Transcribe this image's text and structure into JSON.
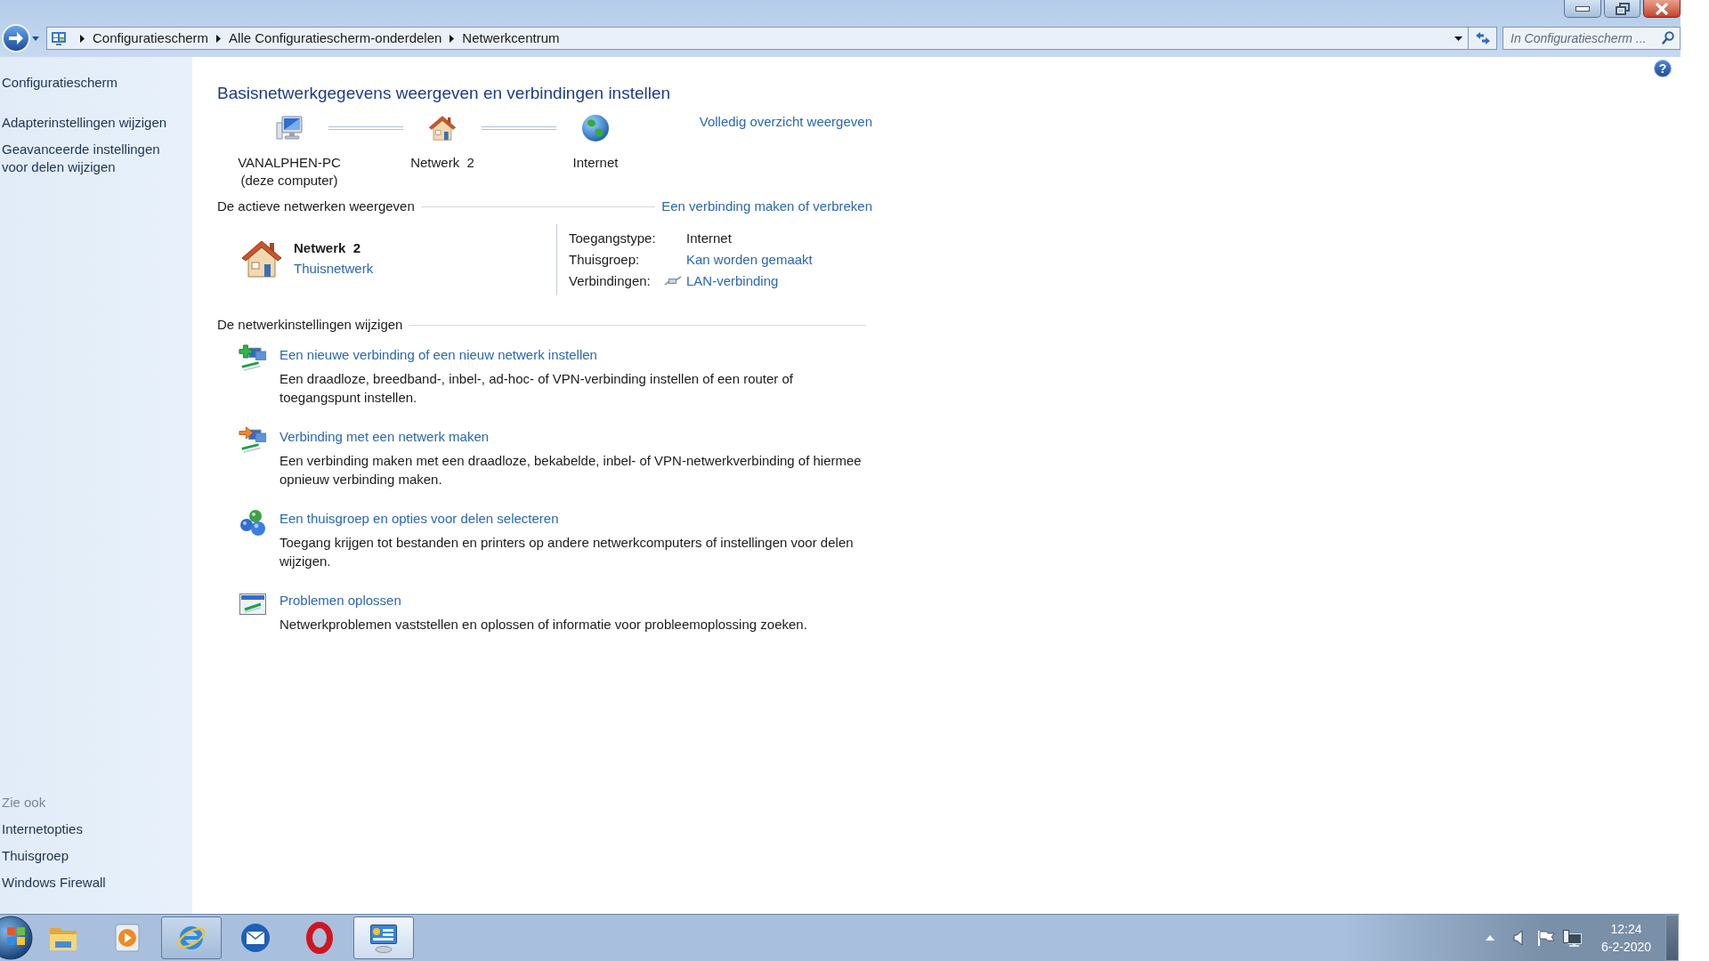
{
  "address_bar": {
    "breadcrumbs": [
      "Configuratiescherm",
      "Alle Configuratiescherm-onderdelen",
      "Netwerkcentrum"
    ]
  },
  "search": {
    "placeholder": "In Configuratiescherm ..."
  },
  "help": {
    "label": "?"
  },
  "sidebar": {
    "home": "Configuratiescherm",
    "tasks": [
      "Adapterinstellingen wijzigen",
      "Geavanceerde instellingen voor delen wijzigen"
    ],
    "see_also": {
      "heading": "Zie ook",
      "items": [
        "Internetopties",
        "Thuisgroep",
        "Windows Firewall"
      ]
    }
  },
  "main": {
    "title": "Basisnetwerkgegevens weergeven en verbindingen instellen",
    "map": {
      "nodes": [
        {
          "kind": "computer",
          "name": "VANALPHEN-PC",
          "detail": "(deze computer)"
        },
        {
          "kind": "network",
          "name": "Netwerk  2"
        },
        {
          "kind": "internet",
          "name": "Internet"
        }
      ],
      "link": "Volledig overzicht weergeven"
    },
    "active_networks": {
      "heading": "De actieve netwerken weergeven",
      "link": "Een verbinding maken of verbreken",
      "network": {
        "name": "Netwerk  2",
        "category": "Thuisnetwerk"
      },
      "properties": [
        {
          "kind": "text",
          "label": "Toegangstype:",
          "value": "Internet"
        },
        {
          "kind": "link",
          "label": "Thuisgroep:",
          "value": "Kan worden gemaakt"
        },
        {
          "kind": "connection",
          "label": "Verbindingen:",
          "value": "LAN-verbinding"
        }
      ]
    },
    "change_settings": {
      "heading": "De netwerkinstellingen wijzigen",
      "tasks": [
        {
          "kind": "new_connection",
          "link": "Een nieuwe verbinding of een nieuw netwerk instellen",
          "description": "Een draadloze, breedband-, inbel-, ad-hoc- of VPN-verbinding instellen of een router of toegangspunt instellen."
        },
        {
          "kind": "connect",
          "link": "Verbinding met een netwerk maken",
          "description": "Een verbinding maken met een draadloze, bekabelde, inbel- of VPN-netwerkverbinding of hiermee opnieuw verbinding maken."
        },
        {
          "kind": "homegroup",
          "link": "Een thuisgroep en opties voor delen selecteren",
          "description": "Toegang krijgen tot bestanden en printers op andere netwerkcomputers of instellingen voor delen wijzigen."
        },
        {
          "kind": "troubleshoot",
          "link": "Problemen oplossen",
          "description": "Netwerkproblemen vaststellen en oplossen of informatie voor probleemoplossing zoeken."
        }
      ]
    }
  },
  "taskbar": {
    "apps": [
      {
        "kind": "folder",
        "running": false,
        "active": false
      },
      {
        "kind": "media",
        "running": false,
        "active": false
      },
      {
        "kind": "browser",
        "running": true,
        "active": false
      },
      {
        "kind": "mail",
        "running": false,
        "active": false
      },
      {
        "kind": "opera",
        "running": false,
        "active": false
      },
      {
        "kind": "control_panel",
        "running": true,
        "active": true
      }
    ],
    "clock": {
      "time": "12:24",
      "date": "6-2-2020"
    }
  }
}
